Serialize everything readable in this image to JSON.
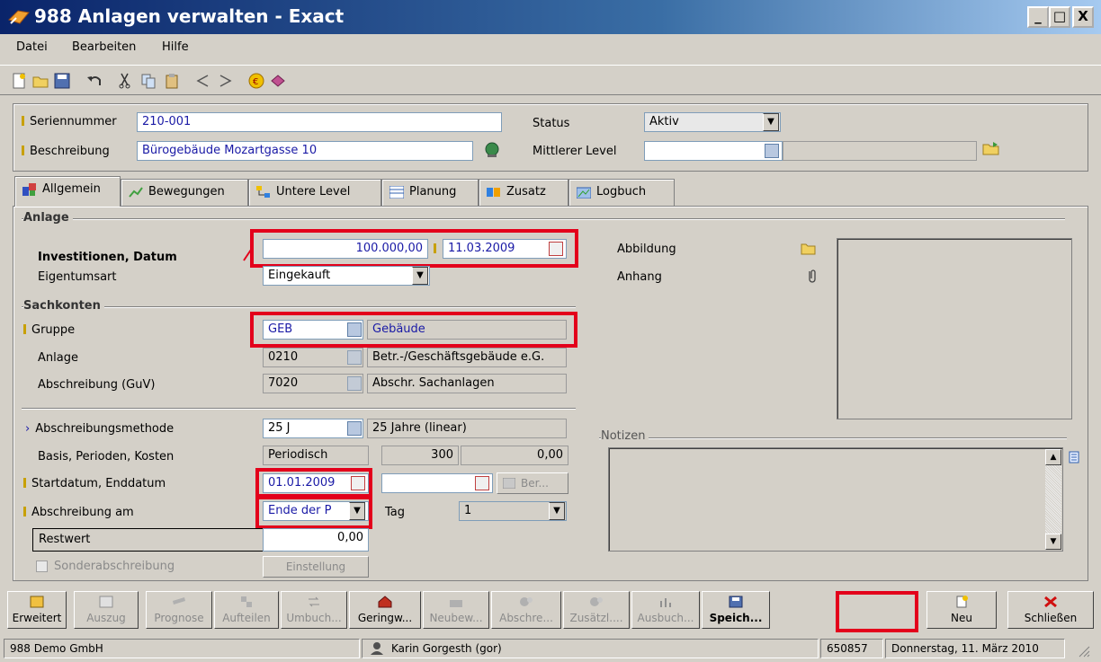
{
  "window": {
    "title": "988 Anlagen verwalten - Exact",
    "min": "_",
    "max": "□",
    "close": "X"
  },
  "menu": [
    "Datei",
    "Bearbeiten",
    "Hilfe"
  ],
  "header": {
    "serial_label": "Seriennummer",
    "serial_value": "210-001",
    "desc_label": "Beschreibung",
    "desc_value": "Bürogebäude Mozartgasse 10",
    "status_label": "Status",
    "status_value": "Aktiv",
    "level_label": "Mittlerer Level",
    "level_value": ""
  },
  "tabs": [
    "Allgemein",
    "Bewegungen",
    "Untere Level",
    "Planung",
    "Zusatz",
    "Logbuch"
  ],
  "anlage": {
    "section": "Anlage",
    "invest_label": "Investitionen, Datum",
    "invest_value": "100.000,00",
    "invest_date": "11.03.2009",
    "ownership_label": "Eigentumsart",
    "ownership_value": "Eingekauft",
    "image_label": "Abbildung",
    "attachment_label": "Anhang"
  },
  "sachkonten": {
    "section": "Sachkonten",
    "group_label": "Gruppe",
    "group_code": "GEB",
    "group_desc": "Gebäude",
    "asset_label": "Anlage",
    "asset_code": "0210",
    "asset_desc": "Betr.-/Geschäftsgebäude e.G.",
    "depr_label": "Abschreibung (GuV)",
    "depr_code": "7020",
    "depr_desc": "Abschr. Sachanlagen"
  },
  "abschreibung": {
    "method_label": "Abschreibungsmethode",
    "method_code": "25 J",
    "method_desc": "25 Jahre (linear)",
    "basis_label": "Basis, Perioden, Kosten",
    "basis_value": "Periodisch",
    "periods_value": "300",
    "cost_value": "0,00",
    "dates_label": "Startdatum, Enddatum",
    "start_date": "01.01.2009",
    "end_date": "",
    "calc_button": "Ber...",
    "on_label": "Abschreibung am",
    "on_value": "Ende der P",
    "day_label": "Tag",
    "day_value": "1",
    "residual_label": "Restwert",
    "residual_value": "0,00",
    "special_label": "Sonderabschreibung",
    "settings_button": "Einstellung"
  },
  "notes_label": "Notizen",
  "buttons": [
    "Erweitert",
    "Auszug",
    "Prognose",
    "Aufteilen",
    "Umbuch...",
    "Geringw...",
    "Neubew...",
    "Abschre...",
    "Zusätzl....",
    "Ausbuch...",
    "Speich...",
    "Neu",
    "Schließen"
  ],
  "status_bar": {
    "company": "988 Demo GmbH",
    "user": "Karin Gorgesth (gor)",
    "code": "650857",
    "date": "Donnerstag, 11. März 2010"
  },
  "colors": {
    "accent_red": "#e3001b",
    "field_text": "#1a1aa6",
    "title_bar": "#0a246a"
  }
}
